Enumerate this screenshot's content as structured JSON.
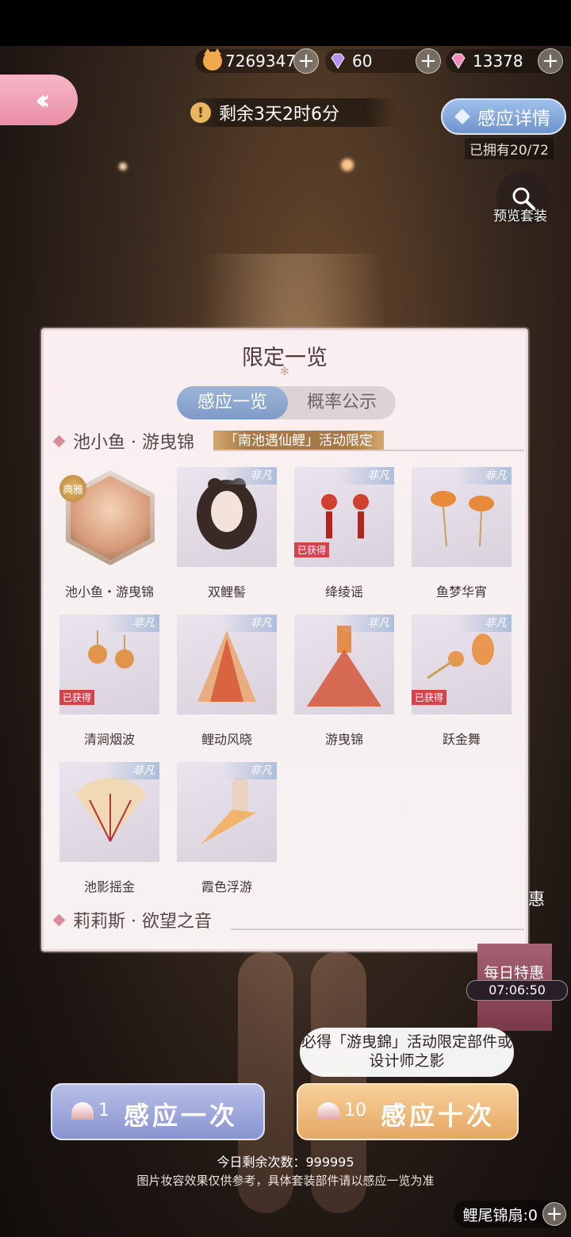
{
  "currency": {
    "coins": "7269347",
    "diamonds_purple": "60",
    "diamonds_pink": "13378"
  },
  "timer": {
    "text": "剩余3天2时6分"
  },
  "detail": {
    "button": "感应详情",
    "owned": "已拥有20/72"
  },
  "preview": {
    "label": "预览套装"
  },
  "modal": {
    "title": "限定一览",
    "tabs": [
      "感应一览",
      "概率公示"
    ],
    "section1": {
      "title": "池小鱼 · 游曳锦",
      "tag": "「南池遇仙鲤」活动限定"
    },
    "items": [
      {
        "name": "池小鱼・游曳锦",
        "tier": "典雅",
        "obtained": false
      },
      {
        "name": "双鲤髻",
        "rank": "非凡",
        "obtained": false
      },
      {
        "name": "绛绫谣",
        "rank": "非凡",
        "obtained": true
      },
      {
        "name": "鱼梦华宵",
        "rank": "非凡",
        "obtained": false
      },
      {
        "name": "清涧烟波",
        "rank": "非凡",
        "obtained": true
      },
      {
        "name": "鲤动风晓",
        "rank": "非凡",
        "obtained": false
      },
      {
        "name": "游曳锦",
        "rank": "非凡",
        "obtained": false
      },
      {
        "name": "跃金舞",
        "rank": "非凡",
        "obtained": true
      },
      {
        "name": "池影摇金",
        "rank": "非凡",
        "obtained": false
      },
      {
        "name": "霞色浮游",
        "rank": "非凡",
        "obtained": false
      }
    ],
    "obtained_label": "已获得",
    "section2": {
      "title": "莉莉斯 · 欲望之音"
    }
  },
  "daily": {
    "label": "每日特惠",
    "time": "07:06:50",
    "youhui": "惠"
  },
  "hint": {
    "text": "必得「游曳錦」活动限定部件或设计师之影"
  },
  "buttons": {
    "one": {
      "count": "1",
      "label": "感应一次"
    },
    "ten": {
      "count": "10",
      "label": "感应十次"
    }
  },
  "footer": {
    "remaining": "今日剩余次数：999995",
    "disclaimer": "图片妆容效果仅供参考，具体套装部件请以感应一览为准",
    "fan_label": "鲤尾锦扇:0"
  },
  "colors": {
    "accent_pink": "#ea8ea6",
    "accent_blue": "#7f9bc6",
    "accent_gold": "#e6a763",
    "obtained_red": "#d4424d"
  }
}
